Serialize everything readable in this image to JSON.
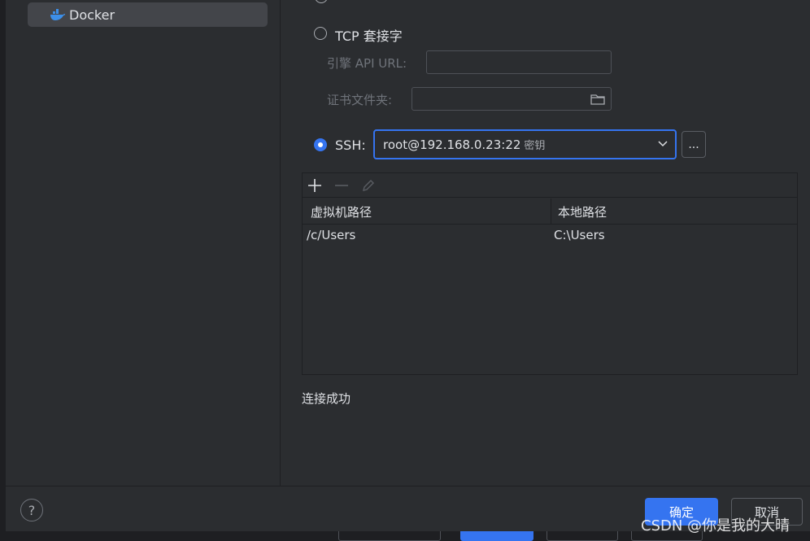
{
  "sidebar": {
    "selected_item": {
      "label": "Docker",
      "icon": "docker-icon"
    }
  },
  "connection": {
    "tcp_label": "TCP 套接字",
    "engine_api_label": "引擎 API URL:",
    "engine_api_value": "",
    "cert_folder_label": "证书文件夹:",
    "cert_folder_value": "",
    "ssh_label": "SSH:",
    "ssh_value": "root@192.168.0.23:22",
    "ssh_auth": "密钥",
    "more_button": "..."
  },
  "path_mappings": {
    "columns": [
      "虚拟机路径",
      "本地路径"
    ],
    "rows": [
      [
        "/c/Users",
        "C:\\Users"
      ]
    ]
  },
  "status_text": "连接成功",
  "footer": {
    "help": "?",
    "ok_label": "确定",
    "cancel_label": "取消"
  },
  "watermark": "CSDN @你是我的大晴",
  "colors": {
    "accent": "#3574f0",
    "background": "#2b2d30",
    "border": "#1e1f22"
  }
}
